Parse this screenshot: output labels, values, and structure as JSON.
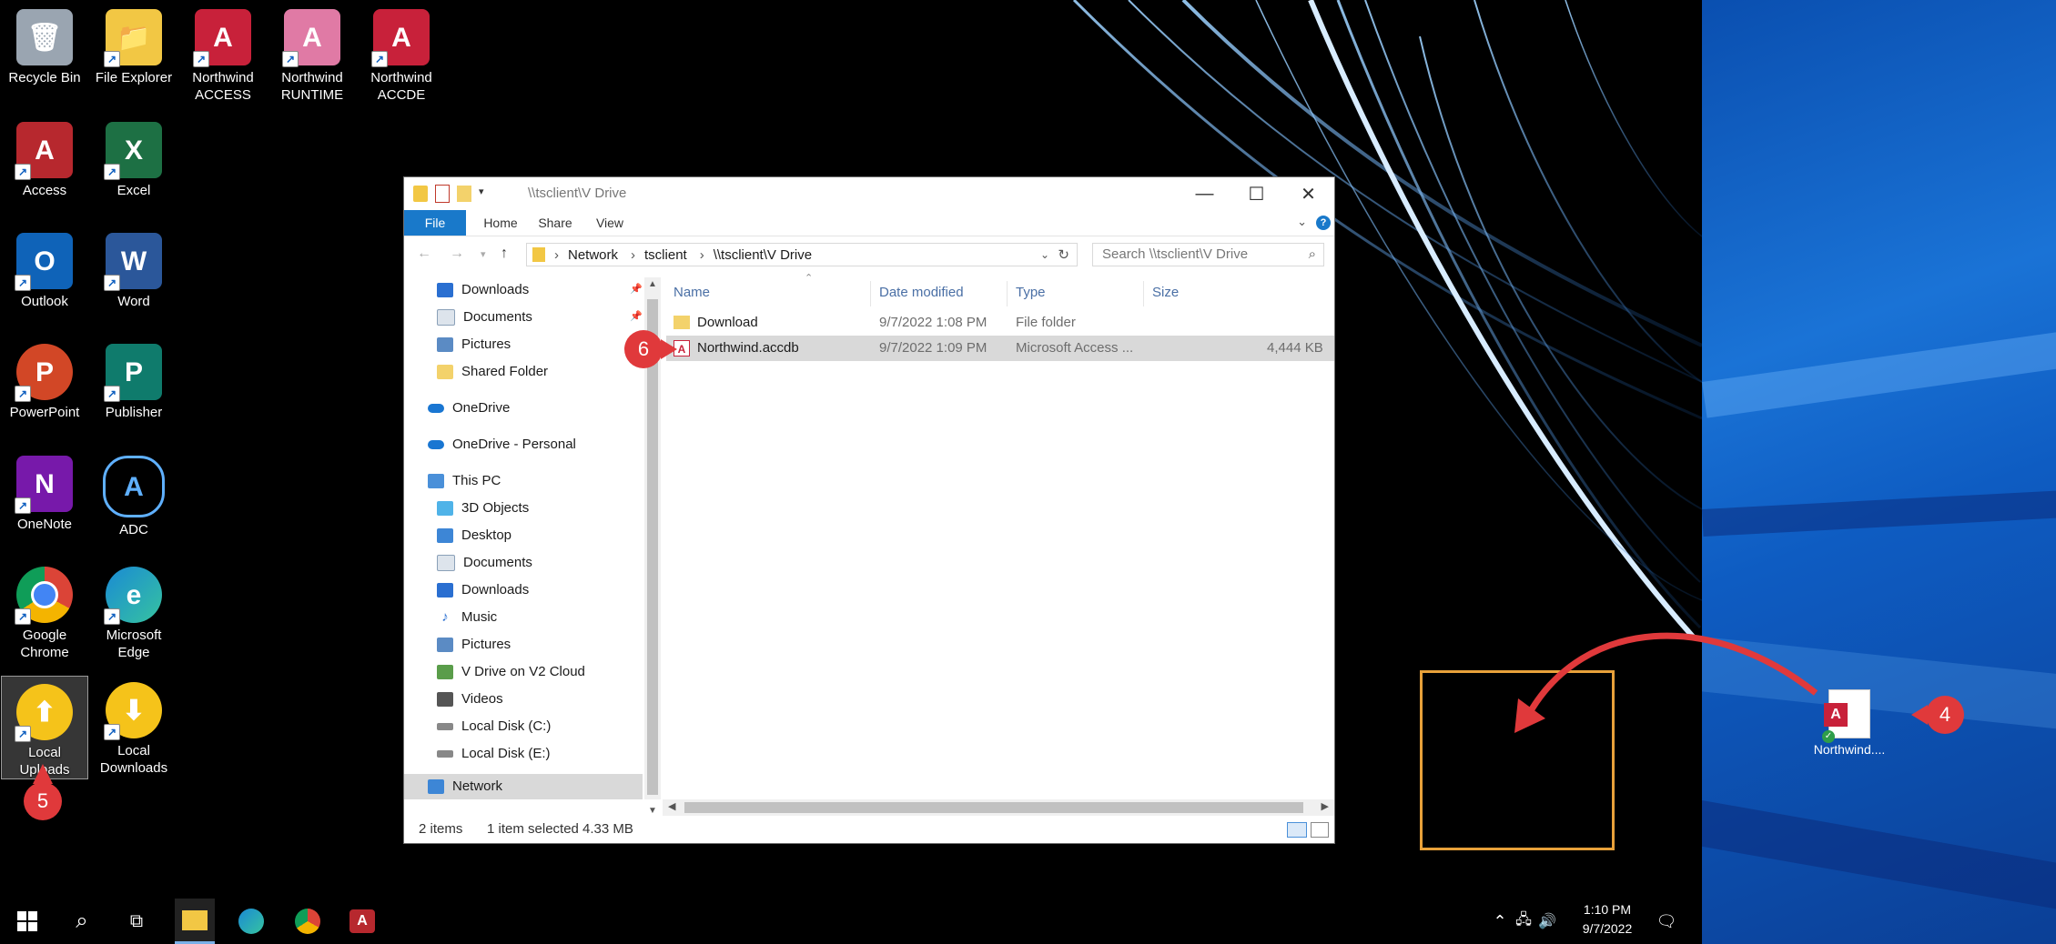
{
  "desktop": {
    "icons": [
      {
        "label": "Recycle Bin",
        "color": "#9aa5b1",
        "glyph": "🗑"
      },
      {
        "label": "File Explorer",
        "color": "#f2c744",
        "glyph": "📁"
      },
      {
        "label": "Northwind ACCESS",
        "color": "#c8213a",
        "glyph": "A"
      },
      {
        "label": "Northwind RUNTIME",
        "color": "#e07aa5",
        "glyph": "A"
      },
      {
        "label": "Northwind ACCDE",
        "color": "#c8213a",
        "glyph": "A"
      },
      {
        "label": "Access",
        "color": "#b7282e",
        "glyph": "A"
      },
      {
        "label": "Excel",
        "color": "#1d7044",
        "glyph": "X"
      },
      {
        "label": "Outlook",
        "color": "#0f63b8",
        "glyph": "O"
      },
      {
        "label": "Word",
        "color": "#2b579a",
        "glyph": "W"
      },
      {
        "label": "PowerPoint",
        "color": "#d24726",
        "glyph": "P"
      },
      {
        "label": "Publisher",
        "color": "#0f7b6c",
        "glyph": "P"
      },
      {
        "label": "OneNote",
        "color": "#7719aa",
        "glyph": "N"
      },
      {
        "label": "ADC",
        "color": "#1e5aa8",
        "glyph": "A"
      },
      {
        "label": "Google Chrome",
        "color": "#e8e8e8",
        "glyph": "◉"
      },
      {
        "label": "Microsoft Edge",
        "color": "#1a8ad4",
        "glyph": "e"
      },
      {
        "label": "Local Uploads",
        "color": "#f5c31a",
        "glyph": "⬆"
      },
      {
        "label": "Local Downloads",
        "color": "#f5c31a",
        "glyph": "⬇"
      }
    ],
    "dragged_file": {
      "label": "Northwind...."
    }
  },
  "explorer": {
    "title": "\\\\tsclient\\V Drive",
    "ribbon_tabs": [
      "File",
      "Home",
      "Share",
      "View"
    ],
    "breadcrumb": [
      "Network",
      "tsclient",
      "\\\\tsclient\\V Drive"
    ],
    "search_placeholder": "Search \\\\tsclient\\V Drive",
    "nav_items": [
      {
        "label": "Downloads",
        "icon": "download-arrow-icon",
        "color": "#2a6fd1"
      },
      {
        "label": "Documents",
        "icon": "document-icon",
        "color": "#8aa0b8"
      },
      {
        "label": "Pictures",
        "icon": "pictures-icon",
        "color": "#5b8bc4"
      },
      {
        "label": "Shared Folder",
        "icon": "folder-icon",
        "color": "#f3d26b"
      },
      {
        "label": "OneDrive",
        "icon": "cloud-icon",
        "color": "#1976d2"
      },
      {
        "label": "OneDrive - Personal",
        "icon": "cloud-icon",
        "color": "#1976d2"
      },
      {
        "label": "This PC",
        "icon": "computer-icon",
        "color": "#4a90d9"
      },
      {
        "label": "3D Objects",
        "icon": "cube-icon",
        "color": "#4fb3e8"
      },
      {
        "label": "Desktop",
        "icon": "desktop-icon",
        "color": "#3d86d6"
      },
      {
        "label": "Documents",
        "icon": "document-icon",
        "color": "#8aa0b8"
      },
      {
        "label": "Downloads",
        "icon": "download-arrow-icon",
        "color": "#2a6fd1"
      },
      {
        "label": "Music",
        "icon": "music-note-icon",
        "color": "#2a6fd1"
      },
      {
        "label": "Pictures",
        "icon": "pictures-icon",
        "color": "#5b8bc4"
      },
      {
        "label": "V Drive on V2 Cloud",
        "icon": "network-drive-icon",
        "color": "#5a9d4a"
      },
      {
        "label": "Videos",
        "icon": "film-icon",
        "color": "#555"
      },
      {
        "label": "Local Disk (C:)",
        "icon": "disk-icon",
        "color": "#888"
      },
      {
        "label": "Local Disk (E:)",
        "icon": "disk-icon",
        "color": "#888"
      },
      {
        "label": "Network",
        "icon": "network-icon",
        "color": "#3d86d6"
      }
    ],
    "columns": [
      "Name",
      "Date modified",
      "Type",
      "Size"
    ],
    "files": [
      {
        "name": "Download",
        "date": "9/7/2022 1:08 PM",
        "type": "File folder",
        "size": ""
      },
      {
        "name": "Northwind.accdb",
        "date": "9/7/2022 1:09 PM",
        "type": "Microsoft Access ...",
        "size": "4,444 KB"
      }
    ],
    "status": {
      "count": "2 items",
      "selection": "1 item selected  4.33 MB"
    }
  },
  "badges": {
    "step4": "4",
    "step5": "5",
    "step6": "6"
  },
  "taskbar": {
    "time": "1:10 PM",
    "date": "9/7/2022"
  }
}
